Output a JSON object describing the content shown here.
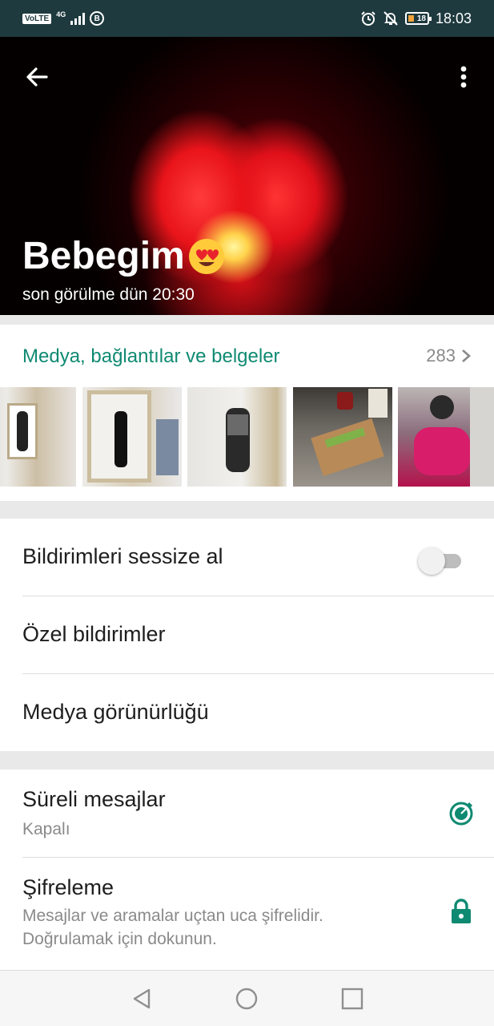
{
  "status_bar": {
    "volte": "VoLTE",
    "network": "4G",
    "battery": "18",
    "time": "18:03"
  },
  "contact": {
    "name": "Bebegim",
    "emoji": "😍",
    "last_seen": "son görülme dün 20:30"
  },
  "media": {
    "title": "Medya, bağlantılar ve belgeler",
    "count": "283"
  },
  "settings": {
    "mute_label": "Bildirimleri sessize al",
    "mute_on": false,
    "custom_notifications": "Özel bildirimler",
    "media_visibility": "Medya görünürlüğü",
    "disappearing_label": "Süreli mesajlar",
    "disappearing_value": "Kapalı",
    "encryption_label": "Şifreleme",
    "encryption_desc_line1": "Mesajlar ve aramalar uçtan uca şifrelidir.",
    "encryption_desc_line2": "Doğrulamak için dokunun."
  },
  "colors": {
    "accent": "#0f8a72",
    "status_bar": "#1e3a3f"
  },
  "icons": [
    "back-arrow-icon",
    "more-vert-icon",
    "chevron-right-icon",
    "timer-icon",
    "lock-icon",
    "nav-back-icon",
    "nav-home-icon",
    "nav-recents-icon"
  ]
}
